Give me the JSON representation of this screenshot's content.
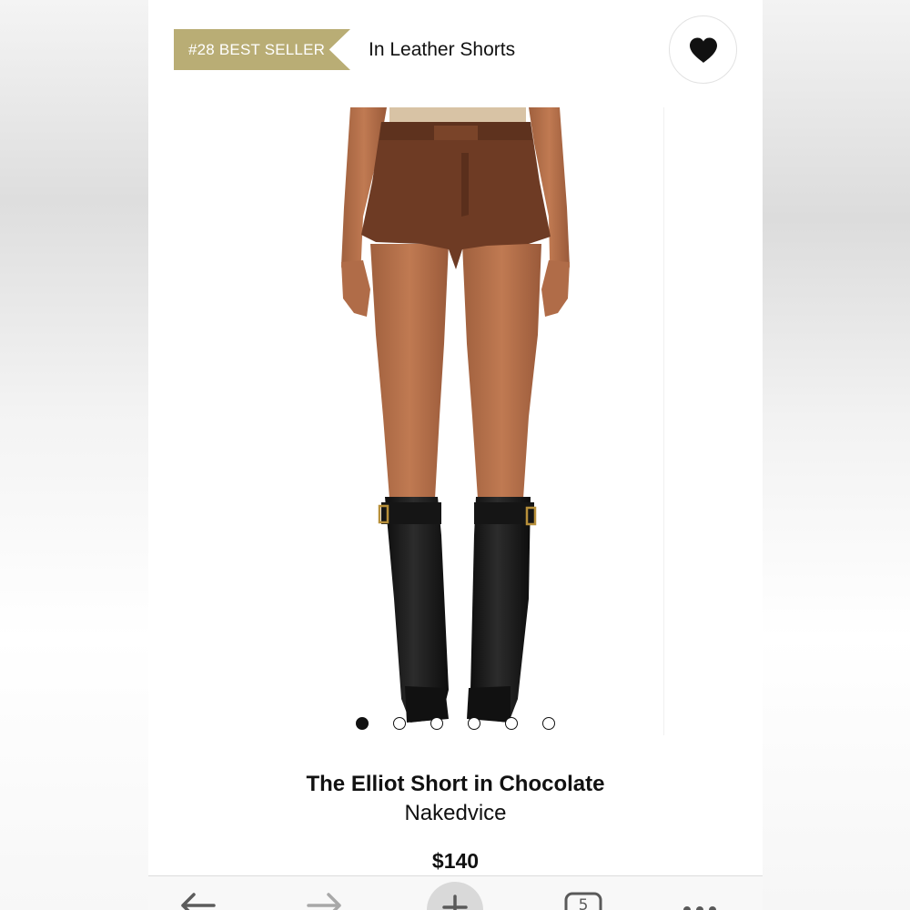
{
  "header": {
    "badge_label": "#28 BEST SELLER",
    "category": "In Leather Shorts",
    "favorite_icon": "heart-icon"
  },
  "product": {
    "name": "The Elliot Short in Chocolate",
    "brand": "Nakedvice",
    "price": "$140",
    "image_count": 6,
    "active_image": 1
  },
  "browser_toolbar": {
    "items": [
      "back-arrow-icon",
      "forward-arrow-icon",
      "new-tab-plus-icon",
      "tabs-count-icon",
      "more-menu-icon"
    ],
    "tab_count": "5"
  },
  "colors": {
    "badge": "#b9ad75",
    "text": "#111111",
    "shorts": "#6e3b24",
    "boots": "#1b1b1b"
  }
}
